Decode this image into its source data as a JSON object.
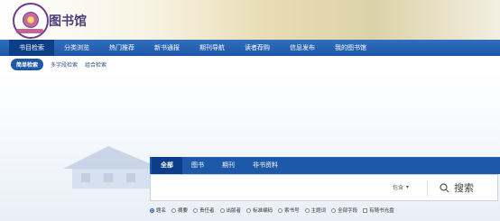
{
  "header": {
    "site_title": "图书馆"
  },
  "nav": {
    "items": [
      {
        "label": "书目检索",
        "active": true
      },
      {
        "label": "分类浏览",
        "active": false
      },
      {
        "label": "热门推荐",
        "active": false
      },
      {
        "label": "新书通报",
        "active": false
      },
      {
        "label": "期刊导航",
        "active": false
      },
      {
        "label": "读者荐购",
        "active": false
      },
      {
        "label": "信息发布",
        "active": false
      },
      {
        "label": "我的图书馆",
        "active": false
      }
    ]
  },
  "subnav": {
    "items": [
      {
        "label": "简单检索",
        "active": true
      },
      {
        "label": "多字段检索",
        "active": false
      },
      {
        "label": "组合检索",
        "active": false
      }
    ]
  },
  "search": {
    "tabs": [
      {
        "label": "全部",
        "active": true
      },
      {
        "label": "图书",
        "active": false
      },
      {
        "label": "期刊",
        "active": false
      },
      {
        "label": "非书资料",
        "active": false
      }
    ],
    "input_value": "",
    "match_mode": "包含",
    "button_label": "搜索"
  },
  "fields": {
    "options": [
      {
        "label": "题名",
        "checked": true
      },
      {
        "label": "摘要",
        "checked": false
      },
      {
        "label": "责任者",
        "checked": false
      },
      {
        "label": "出版者",
        "checked": false
      },
      {
        "label": "标准编码",
        "checked": false
      },
      {
        "label": "索书号",
        "checked": false
      },
      {
        "label": "主题词",
        "checked": false
      },
      {
        "label": "全部字段",
        "checked": false
      }
    ],
    "checkbox_label": "有随书光盘"
  }
}
